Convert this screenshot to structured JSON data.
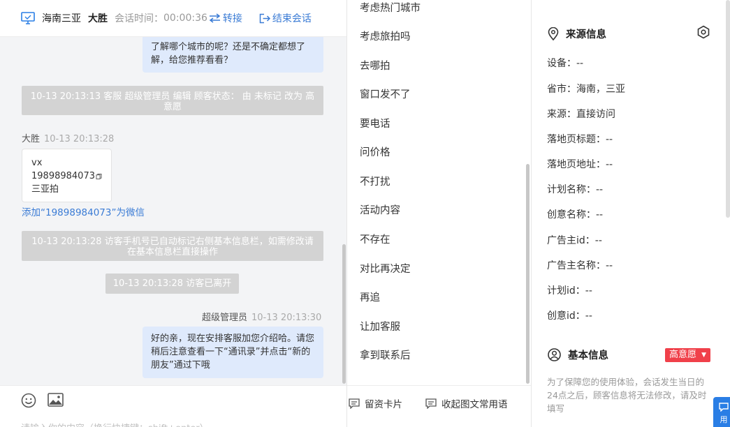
{
  "header": {
    "location": "海南三亚",
    "visitor_name": "大胜",
    "session_time_label": "会话时间：",
    "session_time": "00:00:36",
    "transfer_label": "转接",
    "end_label": "结束会话"
  },
  "messages": {
    "agent_msg_1": "了解哪个城市的呢？还是不确定都想了解，给您推荐看看？",
    "sys_1": "10-13 20:13:13 客服 超级管理员 编辑 顾客状态： 由 未标记 改为 高意愿",
    "visitor_name": "大胜",
    "visitor_time": "10-13 20:13:28",
    "card_line1": "vx",
    "card_phone": "19898984073",
    "card_line3": "三亚拍",
    "add_wechat": "添加“19898984073”为微信",
    "sys_2": "10-13 20:13:28 访客手机号已自动标记右侧基本信息栏，如需修改请在基本信息栏直接操作",
    "sys_3": "10-13 20:13:28 访客已离开",
    "agent_name": "超级管理员",
    "agent_time": "10-13 20:13:30",
    "agent_msg_2": "好的亲，现在安排客服加您介绍哈。请您稍后注意查看一下“通讯录”并点击“新的朋友”通过下哦"
  },
  "composer": {
    "placeholder": "请输入你的内容（换行快捷键：shift+enter）"
  },
  "quick_replies": {
    "items": [
      "考虑热门城市",
      "考虑旅拍吗",
      "去哪拍",
      "窗口发不了",
      "要电话",
      "问价格",
      "不打扰",
      "活动内容",
      "不存在",
      "对比再决定",
      "再追",
      "让加客服",
      "拿到联系后"
    ],
    "leave_card_label": "留资卡片",
    "collapse_label": "收起图文常用语"
  },
  "source_info": {
    "title": "来源信息",
    "rows": [
      {
        "label": "设备：",
        "value": "--"
      },
      {
        "label": "省市：",
        "value": "海南，三亚"
      },
      {
        "label": "来源：",
        "value": "直接访问"
      },
      {
        "label": "落地页标题：",
        "value": "--"
      },
      {
        "label": "落地页地址：",
        "value": "--"
      },
      {
        "label": "计划名称：",
        "value": "--"
      },
      {
        "label": "创意名称：",
        "value": "--"
      },
      {
        "label": "广告主id：",
        "value": "--"
      },
      {
        "label": "广告主名称：",
        "value": "--"
      },
      {
        "label": "计划id：",
        "value": "--"
      },
      {
        "label": "创意id：",
        "value": "--"
      }
    ]
  },
  "basic_info": {
    "title": "基本信息",
    "intent_badge": "高意愿",
    "notice": "为了保障您的使用体验，会话发生当日的24点之后，顾客信息将无法修改，请及时填写"
  },
  "floating": {
    "label": "用"
  },
  "colors": {
    "accent_blue": "#3a7bd5",
    "agent_bubble": "#dfeafc",
    "system_msg": "#d3d3d3",
    "badge_red": "#f0404a"
  }
}
